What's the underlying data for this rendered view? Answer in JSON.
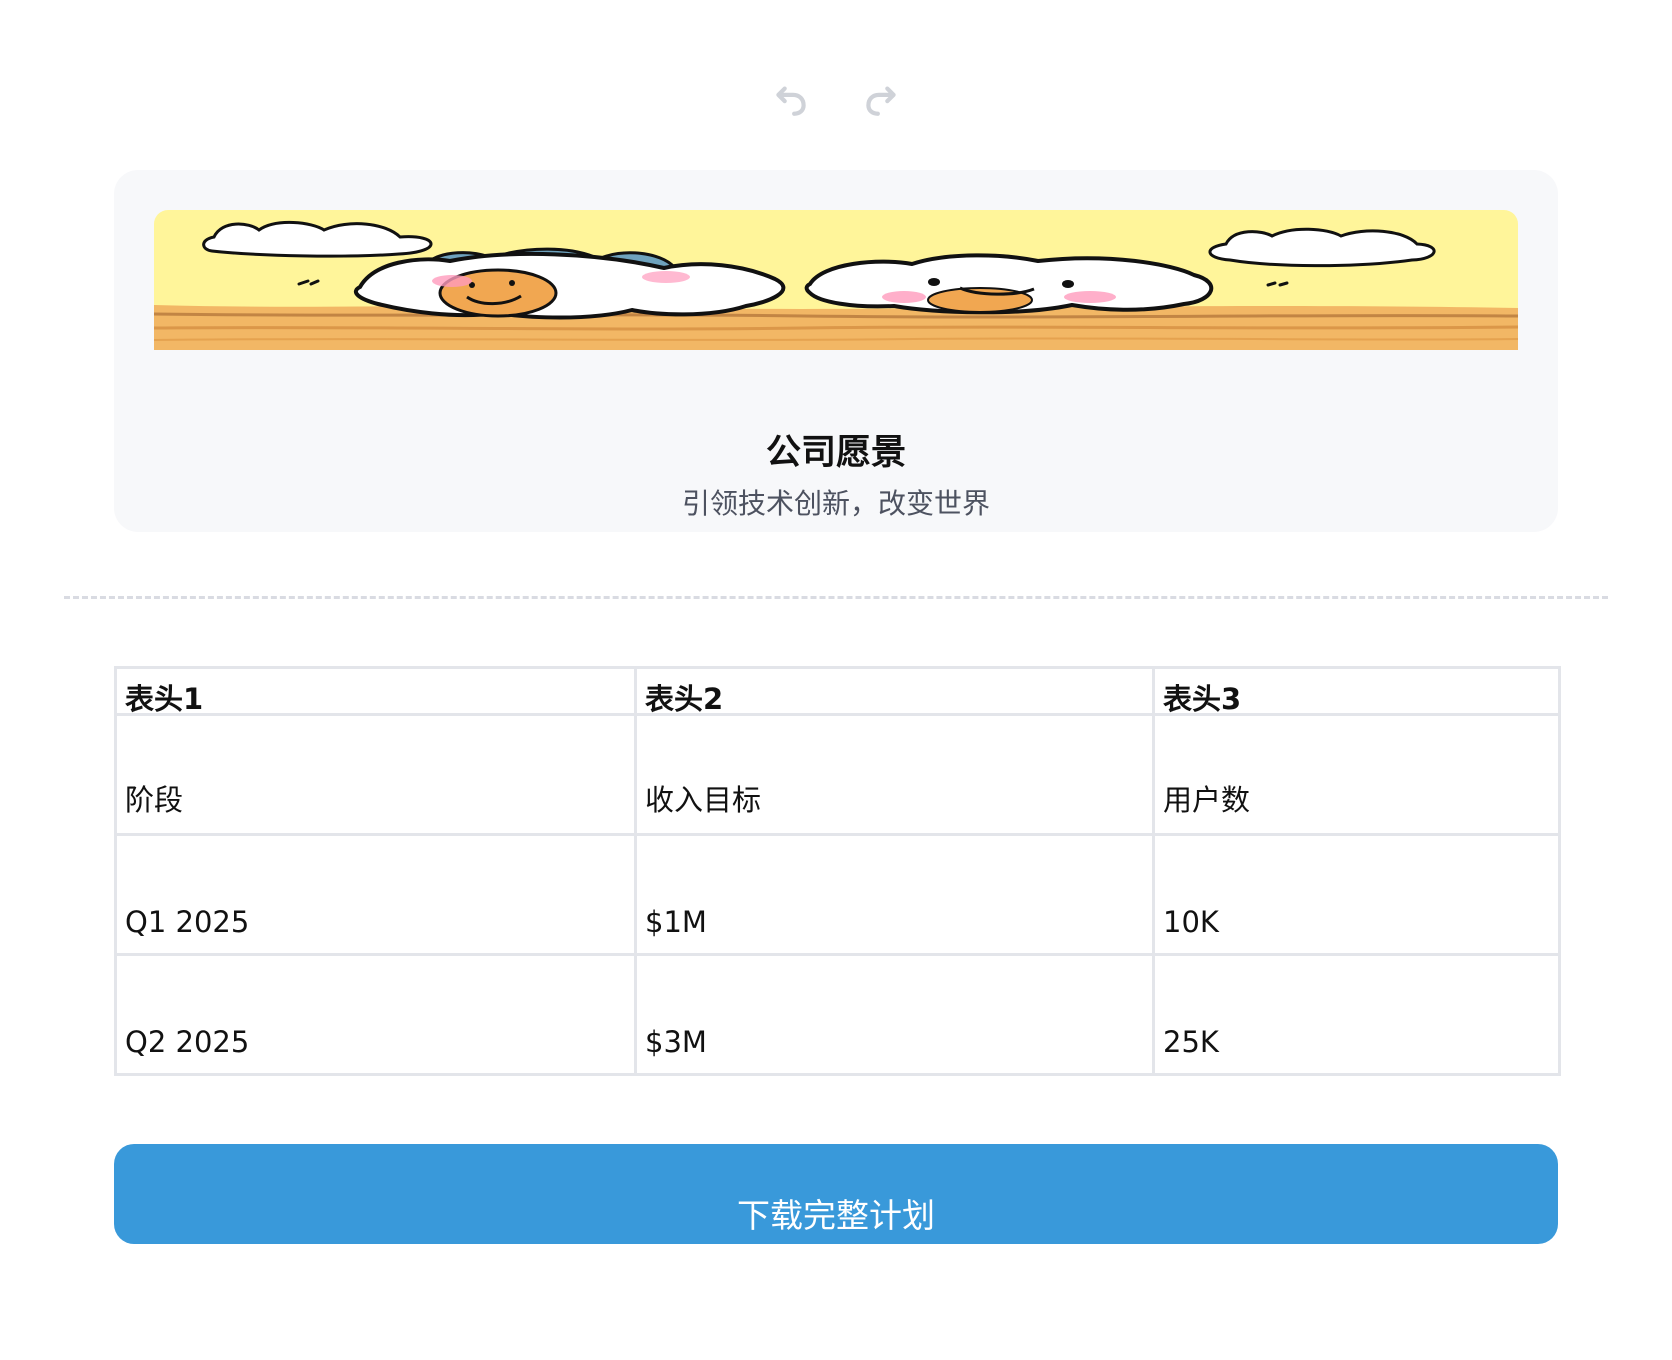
{
  "toolbar": {
    "undo_icon": "undo-icon",
    "redo_icon": "redo-icon",
    "icon_color": "#cfd2d8"
  },
  "hero": {
    "banner_image": "cartoon-animals-banner",
    "title": "公司愿景",
    "subtitle": "引领技术创新，改变世界",
    "background_color": "#f7f8fa"
  },
  "table": {
    "headers": [
      "表头1",
      "表头2",
      "表头3"
    ],
    "rows": [
      [
        "阶段",
        "收入目标",
        "用户数"
      ],
      [
        "Q1 2025",
        "$1M",
        "10K"
      ],
      [
        "Q2 2025",
        "$3M",
        "25K"
      ]
    ],
    "border_color": "#e3e5ea"
  },
  "action": {
    "download_label": "下载完整计划",
    "button_color": "#3999da"
  }
}
